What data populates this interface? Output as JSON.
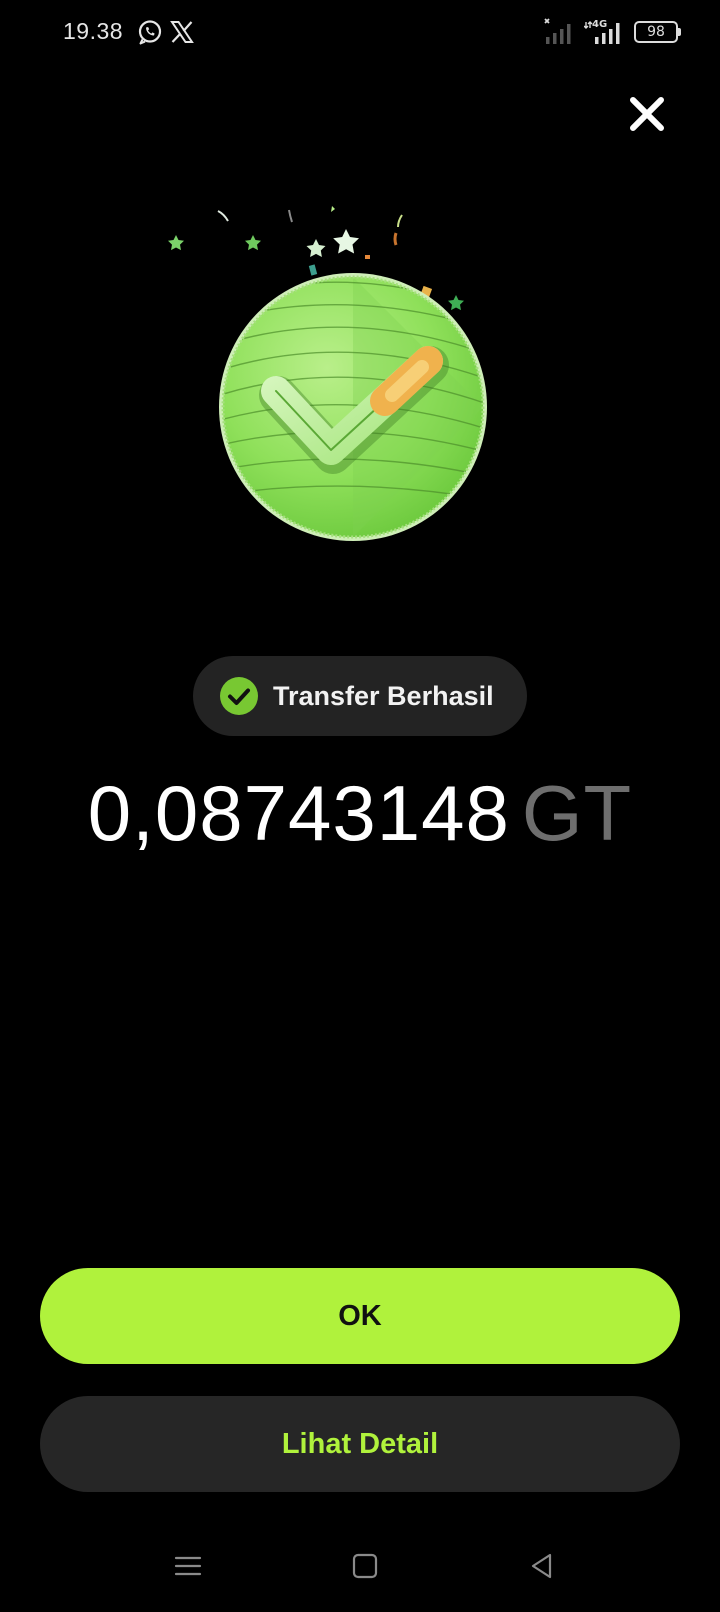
{
  "status_bar": {
    "time": "19.38",
    "network": "4G",
    "battery": "98"
  },
  "status_pill": {
    "label": "Transfer Berhasil"
  },
  "amount": {
    "value": "0,08743148",
    "unit": "GT"
  },
  "buttons": {
    "ok_label": "OK",
    "detail_label": "Lihat Detail"
  },
  "colors": {
    "background": "#000000",
    "accent": "#b0f23c",
    "pill_bg": "#232323",
    "secondary_button_bg": "#262626",
    "unit_text": "#6e6e6e"
  },
  "icons": {
    "close": "close-icon",
    "success": "check-circle-icon",
    "illustration": "success-coin-checkmark-illustration"
  }
}
